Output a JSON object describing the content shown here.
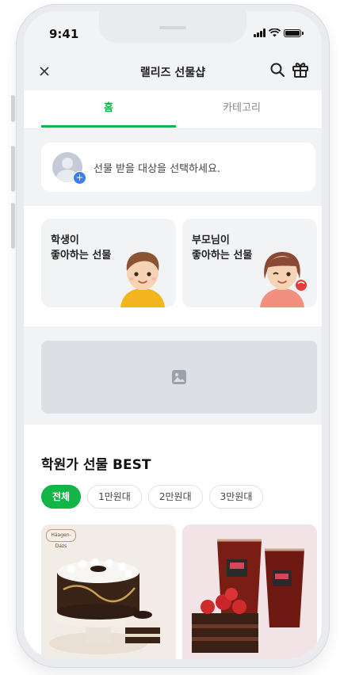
{
  "status_bar": {
    "time": "9:41"
  },
  "header": {
    "title": "랠리즈 선물샵"
  },
  "tabs": [
    {
      "label": "홈",
      "active": true
    },
    {
      "label": "카테고리",
      "active": false
    }
  ],
  "recipient": {
    "prompt": "선물 받을 대상을 선택하세요."
  },
  "category_cards": [
    {
      "label": "학생이\n좋아하는 선물"
    },
    {
      "label": "부모님이\n좋아하는 선물"
    }
  ],
  "best_section": {
    "title": "학원가 선물 BEST",
    "chips": [
      {
        "label": "전체",
        "active": true
      },
      {
        "label": "1만원대",
        "active": false
      },
      {
        "label": "2만원대",
        "active": false
      },
      {
        "label": "3만원대",
        "active": false
      }
    ],
    "products": [
      {
        "brand": "Häagen-Dazs"
      },
      {
        "brand": ""
      }
    ]
  },
  "colors": {
    "accent": "#12b546",
    "background": "#f2f3f5",
    "banner_placeholder": "#dcdfe4"
  },
  "icons": [
    "close-icon",
    "search-icon",
    "gift-icon",
    "image-placeholder-icon",
    "plus-icon"
  ]
}
